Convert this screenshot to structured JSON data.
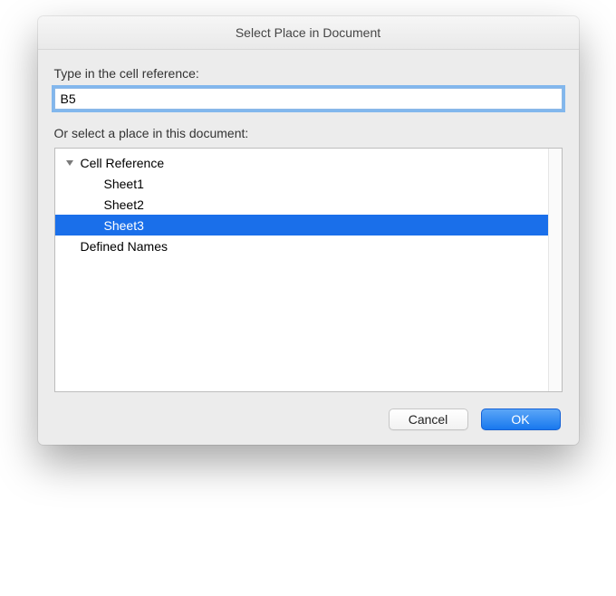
{
  "window": {
    "title": "Select Place in Document"
  },
  "labels": {
    "cell_ref": "Type in the cell reference:",
    "or_select": "Or select a place in this document:"
  },
  "input": {
    "value": "B5"
  },
  "tree": {
    "group_cell_ref": "Cell Reference",
    "sheet1": "Sheet1",
    "sheet2": "Sheet2",
    "sheet3": "Sheet3",
    "defined_names": "Defined Names"
  },
  "buttons": {
    "cancel": "Cancel",
    "ok": "OK"
  }
}
